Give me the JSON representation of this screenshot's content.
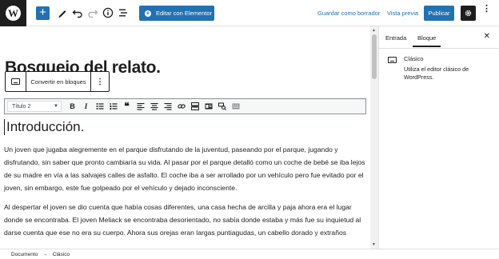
{
  "toolbar": {
    "add_symbol": "+",
    "elementor_label": "Editar con Elementor",
    "save_draft_label": "Guardar como borrador",
    "preview_label": "Vista previa",
    "publish_label": "Publicar"
  },
  "editor": {
    "post_title": "Bosquejo del relato.",
    "convert_label": "Convertir en bloques",
    "heading_select_value": "Título 2",
    "heading_text": "Introducción.",
    "paragraphs": [
      "Un joven que jugaba alegremente en el parque disfrutando de la juventud, paseando por el parque, jugando y disfrutando, sin saber que pronto cambiaría su vida. Al pasar por el parque detalló como un coche de bebé se iba lejos de su madre en vía a las salvajes calles de asfalto. El coche iba a ser arrollado por un vehículo pero fue evitado por el joven, sin embargo, este fue golpeado por el vehículo y dejado inconsciente.",
      "Al despertar el joven se dio cuenta que había cosas diferentes, una casa hecha de arcilla y paja ahora era el lugar donde se encontraba. El joven Meliack se encontraba desorientado, no sabía donde estaba y más fue su inquietud al darse cuenta que ese no era su cuerpo. Ahora sus orejas eran largas puntiagudas, un cabello dorado y extraños"
    ]
  },
  "sidebar": {
    "tab_post": "Entrada",
    "tab_block": "Bloque",
    "block_name": "Clásico",
    "block_description": "Utiliza el editor clásico de WordPress."
  },
  "footer": {
    "crumb_document": "Documento",
    "separator": "→",
    "crumb_block": "Clásico"
  },
  "colors": {
    "accent": "#2271b1",
    "dark": "#1e1e1e"
  }
}
